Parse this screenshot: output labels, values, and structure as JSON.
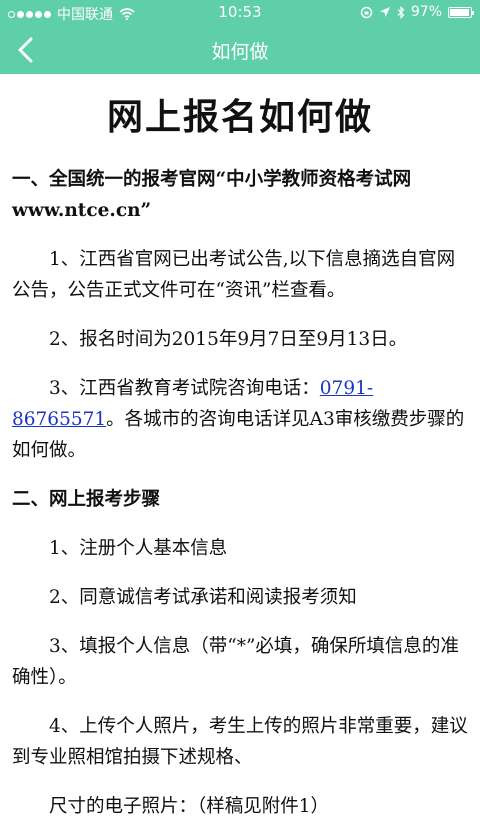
{
  "status_bar": {
    "carrier": "中国联通",
    "time": "10:53",
    "battery_percent_text": "97%",
    "battery_level": 0.97
  },
  "nav": {
    "title": "如何做"
  },
  "doc": {
    "title": "网上报名如何做",
    "section1_heading": "一、全国统一的报考官网“中小学教师资格考试网www.ntce.cn”",
    "p1": "1、江西省官网已出考试公告,以下信息摘选自官网公告，公告正式文件可在“资讯”栏查看。",
    "p2": "2、报名时间为2015年9月7日至9月13日。",
    "p3_prefix": "3、江西省教育考试院咨询电话：",
    "p3_phone": "0791-86765571",
    "p3_suffix": "。各城市的咨询电话详见A3审核缴费步骤的如何做。",
    "section2_heading": "二、网上报考步骤",
    "s1": "1、注册个人基本信息",
    "s2": "2、同意诚信考试承诺和阅读报考须知",
    "s3": "3、填报个人信息（带“*”必填，确保所填信息的准确性）。",
    "s4": "4、上传个人照片，考生上传的照片非常重要，建议到专业照相馆拍摄下述规格、",
    "s5": "尺寸的电子照片：（样稿见附件1）"
  },
  "colors": {
    "header": "#5fcfa9",
    "link": "#1a34c8"
  },
  "icons": {
    "back": "chevron-left-icon",
    "wifi": "wifi-icon",
    "location": "location-arrow-icon",
    "bluetooth": "bluetooth-icon",
    "lock": "rotation-lock-icon",
    "battery": "battery-icon"
  }
}
